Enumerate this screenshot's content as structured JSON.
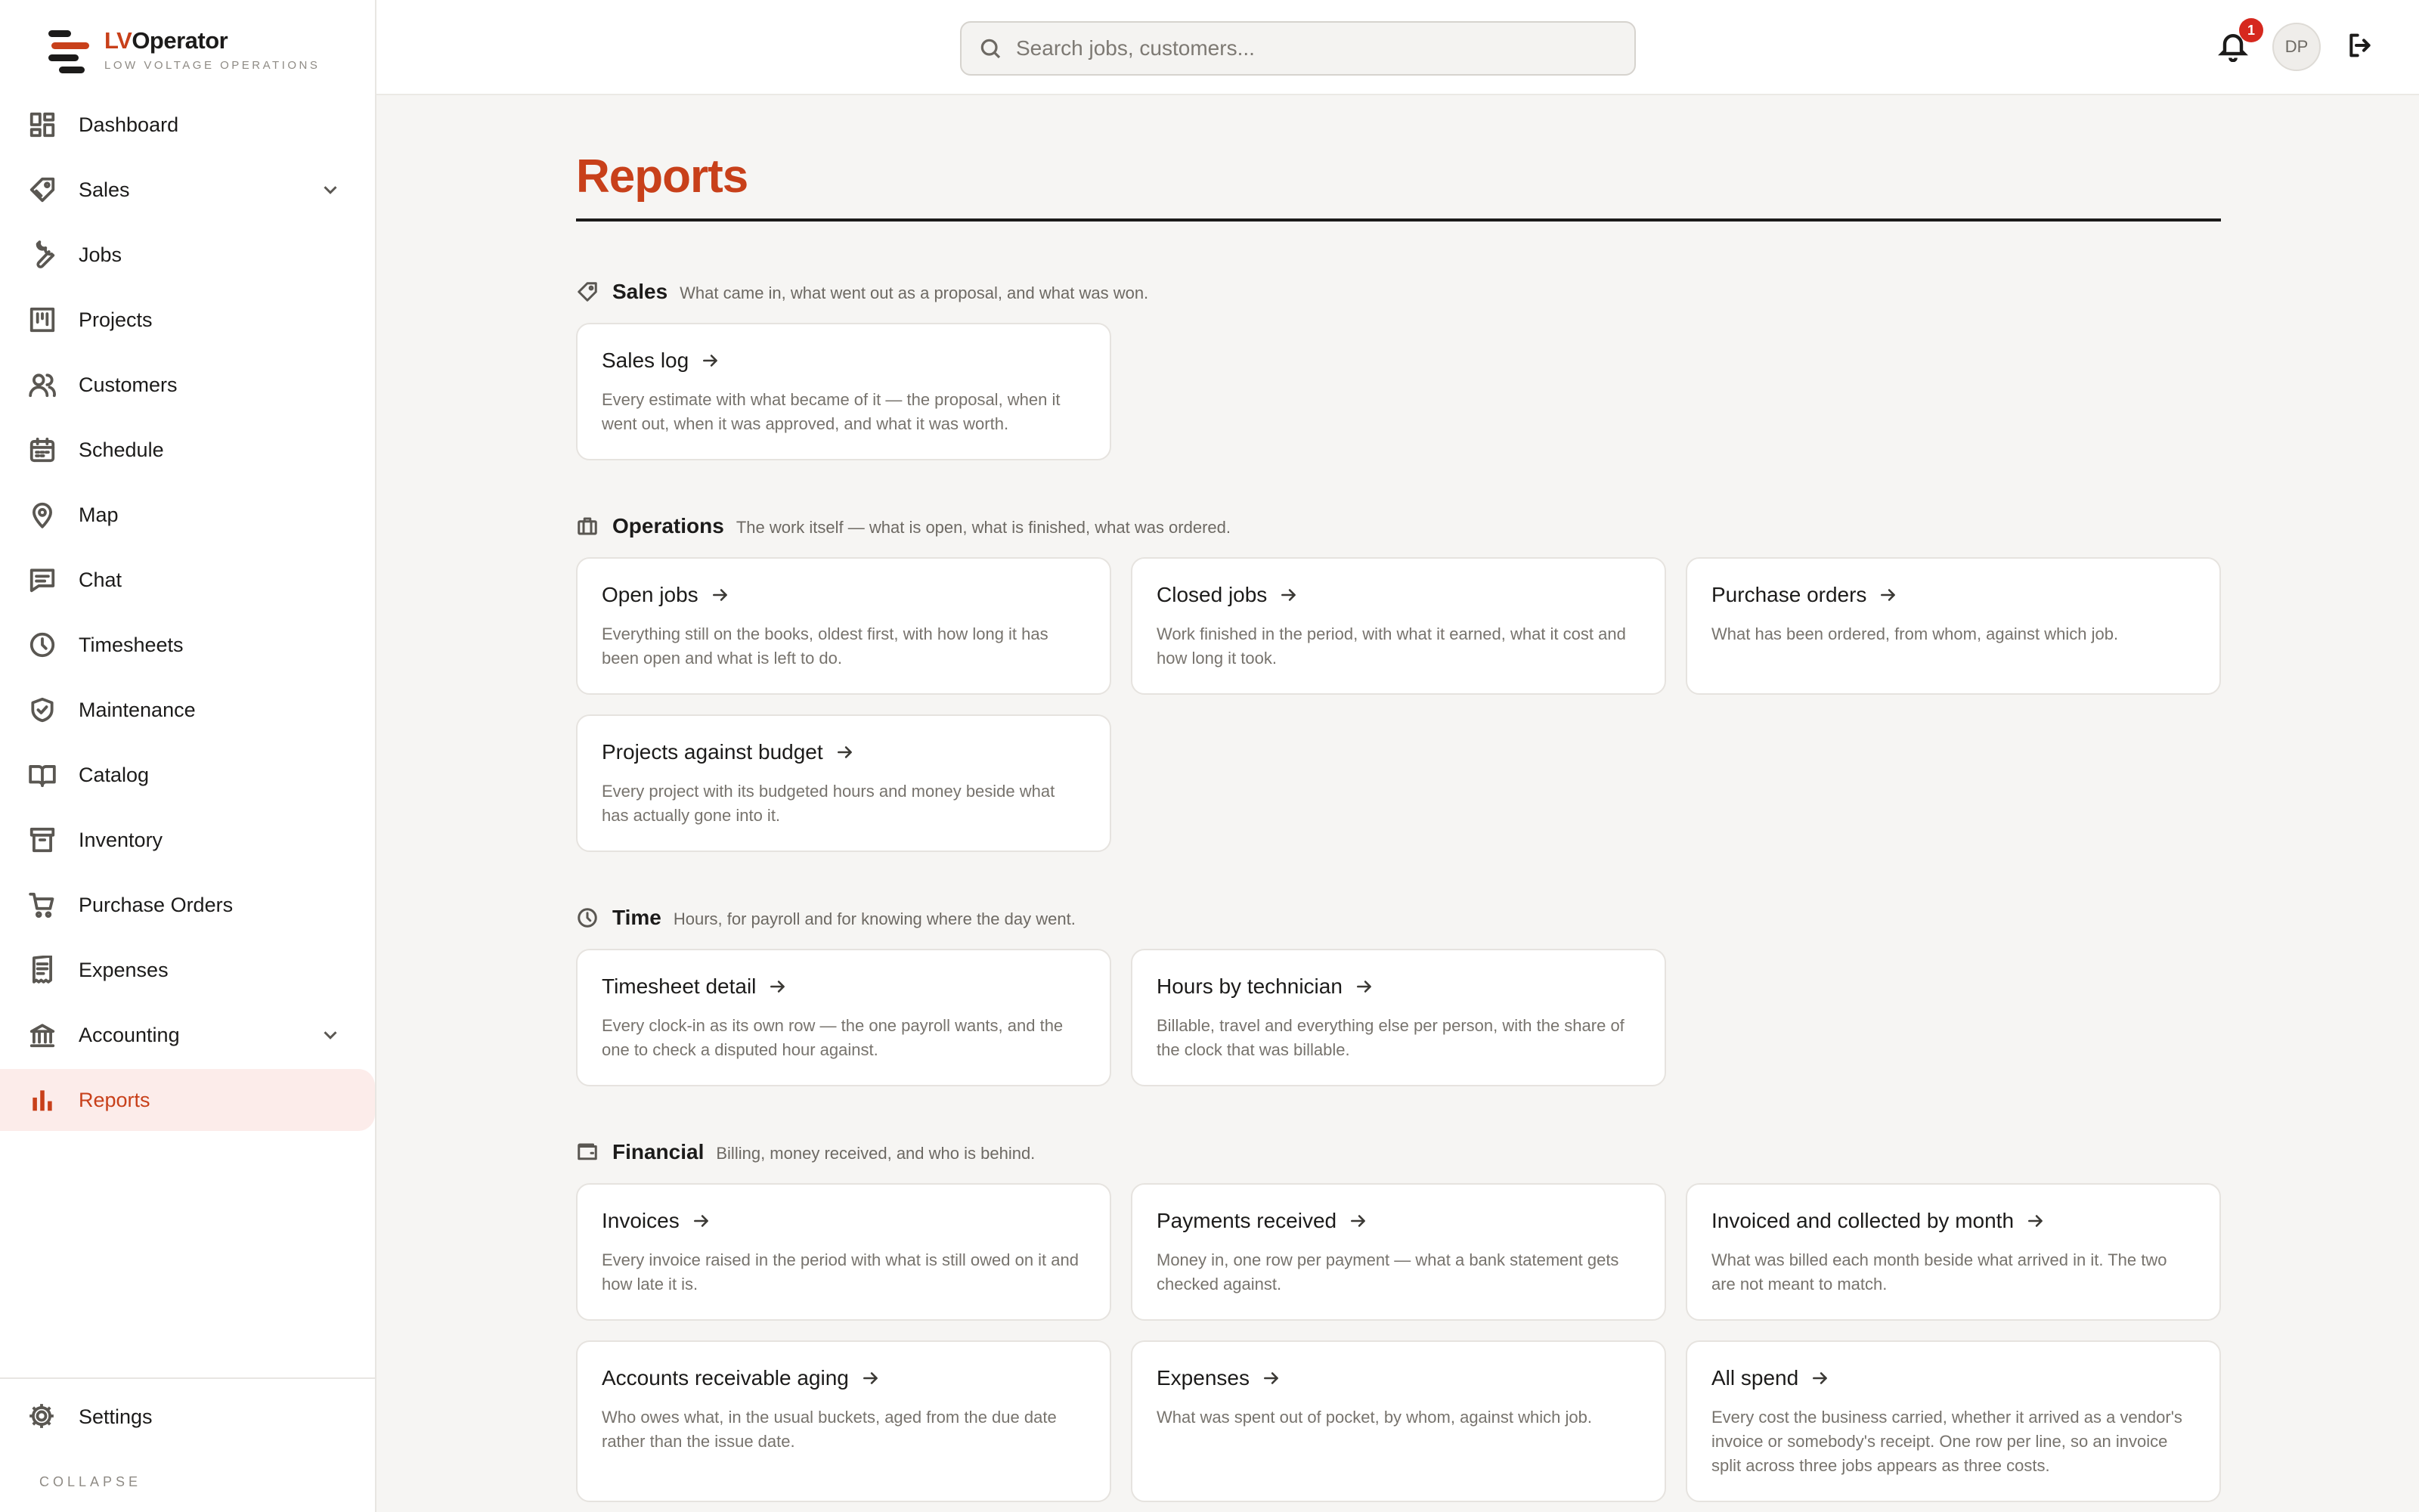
{
  "brand": {
    "prefix": "LV",
    "suffix": "Operator",
    "tagline": "LOW VOLTAGE OPERATIONS"
  },
  "search": {
    "placeholder": "Search jobs, customers..."
  },
  "header": {
    "notification_count": "1",
    "avatar_initials": "DP"
  },
  "sidebar": {
    "items": [
      {
        "label": "Dashboard",
        "icon": "dashboard-icon"
      },
      {
        "label": "Sales",
        "icon": "tag-icon",
        "expandable": true
      },
      {
        "label": "Jobs",
        "icon": "wrench-icon"
      },
      {
        "label": "Projects",
        "icon": "kanban-icon"
      },
      {
        "label": "Customers",
        "icon": "users-icon"
      },
      {
        "label": "Schedule",
        "icon": "calendar-icon"
      },
      {
        "label": "Map",
        "icon": "map-pin-icon"
      },
      {
        "label": "Chat",
        "icon": "chat-icon"
      },
      {
        "label": "Timesheets",
        "icon": "clock-icon"
      },
      {
        "label": "Maintenance",
        "icon": "shield-check-icon"
      },
      {
        "label": "Catalog",
        "icon": "book-icon"
      },
      {
        "label": "Inventory",
        "icon": "archive-icon"
      },
      {
        "label": "Purchase Orders",
        "icon": "cart-icon"
      },
      {
        "label": "Expenses",
        "icon": "receipt-icon"
      },
      {
        "label": "Accounting",
        "icon": "bank-icon",
        "expandable": true
      },
      {
        "label": "Reports",
        "icon": "bar-chart-icon",
        "active": true
      }
    ],
    "settings_label": "Settings",
    "collapse_label": "COLLAPSE"
  },
  "page": {
    "title": "Reports"
  },
  "sections": [
    {
      "title": "Sales",
      "description": "What came in, what went out as a proposal, and what was won.",
      "cards": [
        {
          "title": "Sales log",
          "description": "Every estimate with what became of it — the proposal, when it went out, when it was approved, and what it was worth."
        }
      ]
    },
    {
      "title": "Operations",
      "description": "The work itself — what is open, what is finished, what was ordered.",
      "cards": [
        {
          "title": "Open jobs",
          "description": "Everything still on the books, oldest first, with how long it has been open and what is left to do."
        },
        {
          "title": "Closed jobs",
          "description": "Work finished in the period, with what it earned, what it cost and how long it took."
        },
        {
          "title": "Purchase orders",
          "description": "What has been ordered, from whom, against which job."
        },
        {
          "title": "Projects against budget",
          "description": "Every project with its budgeted hours and money beside what has actually gone into it."
        }
      ]
    },
    {
      "title": "Time",
      "description": "Hours, for payroll and for knowing where the day went.",
      "cards": [
        {
          "title": "Timesheet detail",
          "description": "Every clock-in as its own row — the one payroll wants, and the one to check a disputed hour against."
        },
        {
          "title": "Hours by technician",
          "description": "Billable, travel and everything else per person, with the share of the clock that was billable."
        }
      ]
    },
    {
      "title": "Financial",
      "description": "Billing, money received, and who is behind.",
      "cards": [
        {
          "title": "Invoices",
          "description": "Every invoice raised in the period with what is still owed on it and how late it is."
        },
        {
          "title": "Payments received",
          "description": "Money in, one row per payment — what a bank statement gets checked against."
        },
        {
          "title": "Invoiced and collected by month",
          "description": "What was billed each month beside what arrived in it. The two are not meant to match."
        },
        {
          "title": "Accounts receivable aging",
          "description": "Who owes what, in the usual buckets, aged from the due date rather than the issue date."
        },
        {
          "title": "Expenses",
          "description": "What was spent out of pocket, by whom, against which job."
        },
        {
          "title": "All spend",
          "description": "Every cost the business carried, whether it arrived as a vendor's invoice or somebody's receipt. One row per line, so an invoice split across three jobs appears as three costs."
        }
      ]
    }
  ]
}
